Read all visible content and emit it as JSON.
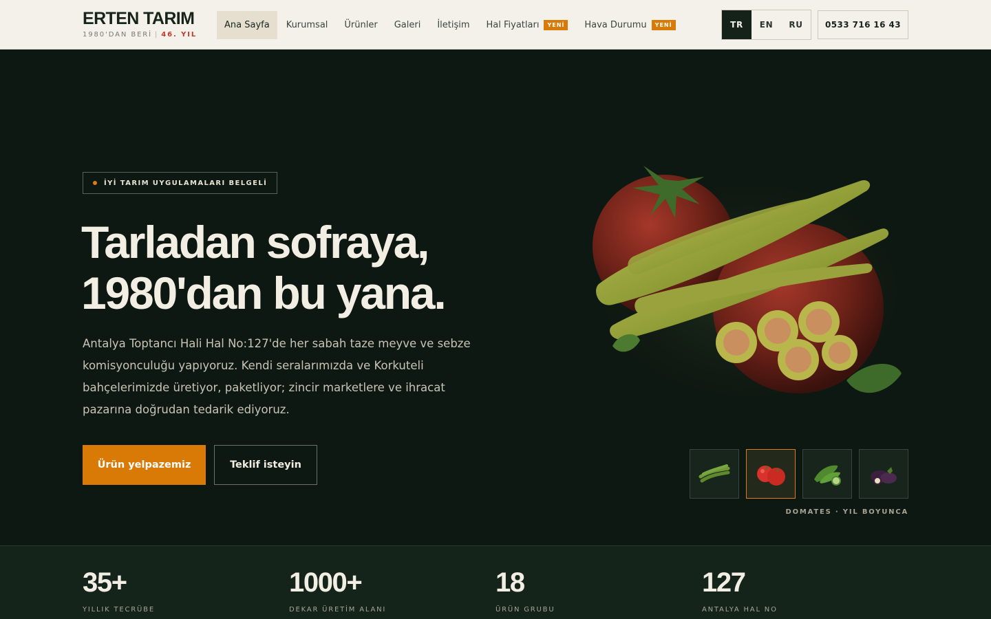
{
  "brand": {
    "name": "ERTEN TARIM",
    "since": "1980'DAN BERİ",
    "separator": "|",
    "year": "46. YIL"
  },
  "nav": {
    "items": [
      {
        "label": "Ana Sayfa",
        "active": true
      },
      {
        "label": "Kurumsal"
      },
      {
        "label": "Ürünler"
      },
      {
        "label": "Galeri"
      },
      {
        "label": "İletişim"
      },
      {
        "label": "Hal Fiyatları",
        "badge": "YENİ"
      },
      {
        "label": "Hava Durumu",
        "badge": "YENİ"
      }
    ]
  },
  "languages": {
    "items": [
      "TR",
      "EN",
      "RU"
    ],
    "active": "TR"
  },
  "phone": "0533 716 16 43",
  "hero": {
    "certificate": "İYİ TARIM UYGULAMALARI BELGELİ",
    "headline": [
      "Tarladan sofraya,",
      "1980'dan bu yana."
    ],
    "lead": "Antalya Toptancı Hali Hal No:127'de her sabah taze meyve ve sebze komisyonculuğu yapıyoruz. Kendi seralarımızda ve Korkuteli bahçelerimizde üretiyor, paketliyor; zincir marketlere ve ihracat pazarına doğrudan tedarik ediyoruz.",
    "primary_button": "Ürün yelpazemiz",
    "secondary_button": "Teklif isteyin",
    "image_icon": "tomato-pepper-illustration",
    "thumbnails": [
      {
        "icon": "green-bean-icon",
        "active": false
      },
      {
        "icon": "tomato-icon",
        "active": true
      },
      {
        "icon": "cucumber-icon",
        "active": false
      },
      {
        "icon": "eggplant-icon",
        "active": false
      }
    ],
    "caption": "DOMATES · YIL BOYUNCA"
  },
  "stats": [
    {
      "value": "35+",
      "label": "YILLIK TECRÜBE"
    },
    {
      "value": "1000+",
      "label": "DEKAR ÜRETİM ALANI"
    },
    {
      "value": "18",
      "label": "ÜRÜN GRUBU"
    },
    {
      "value": "127",
      "label": "ANTALYA HAL NO"
    }
  ],
  "colors": {
    "accent": "#d97a06",
    "dark": "#0e1812",
    "cream": "#f4f1ea",
    "brand_red": "#c0392b"
  }
}
